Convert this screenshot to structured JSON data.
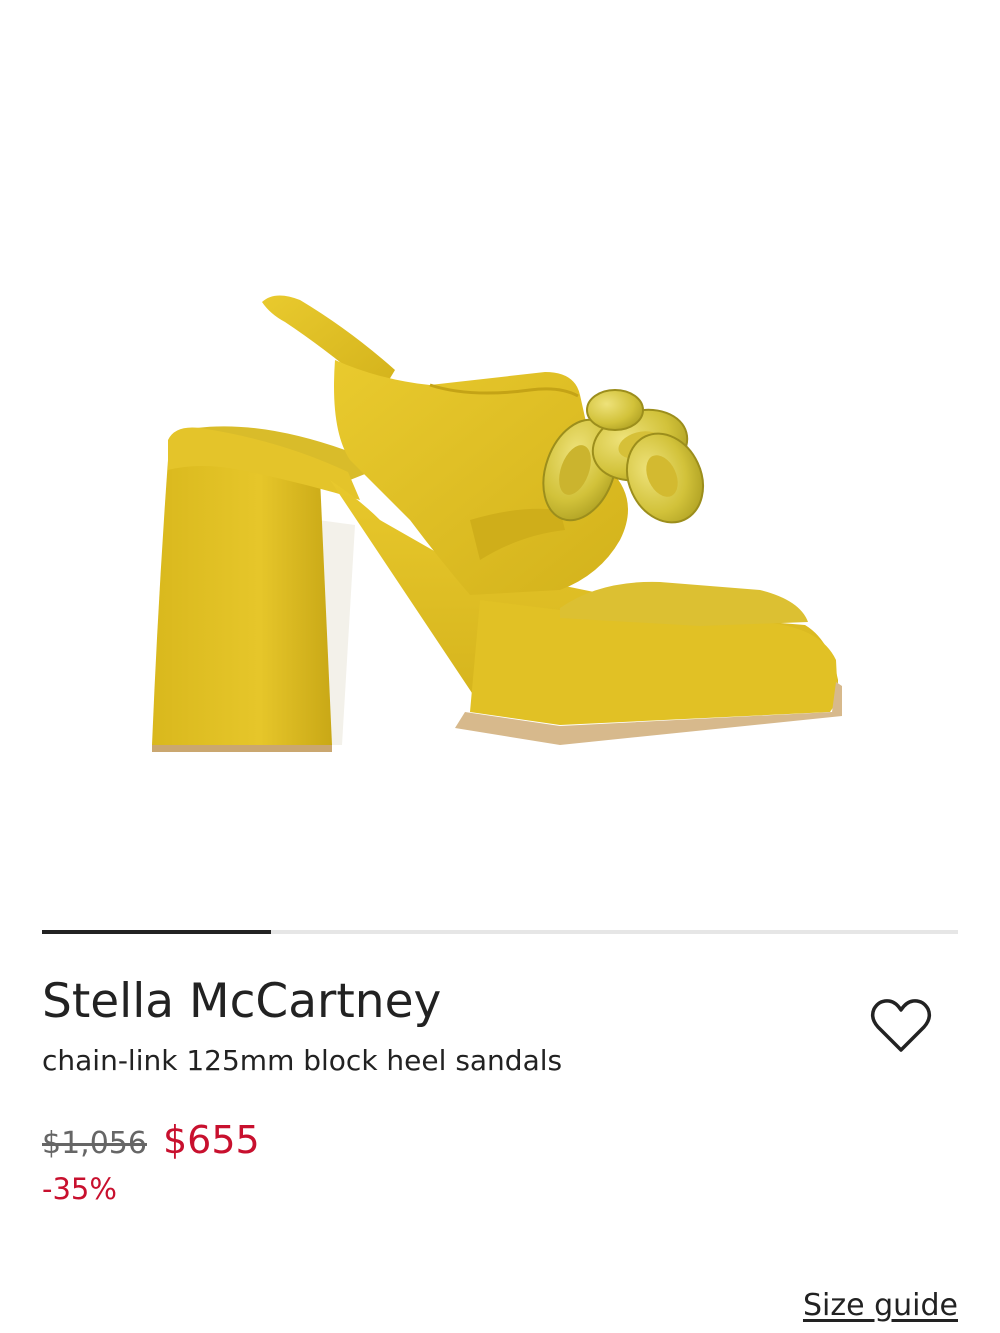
{
  "product": {
    "image_alt": "yellow chain-link platform block heel sandal",
    "brand": "Stella McCartney",
    "name": "chain-link 125mm block heel sandals",
    "price_original": "$1,056",
    "price_sale": "$655",
    "discount": "-35%",
    "carousel_progress": 0.25
  },
  "actions": {
    "wishlist_icon": "heart-outline-icon",
    "size_guide_label": "Size guide"
  },
  "colors": {
    "sale_red": "#c8102e",
    "text": "#222222",
    "shoe_yellow": "#e2c325",
    "sole_tan": "#d2b48c"
  }
}
